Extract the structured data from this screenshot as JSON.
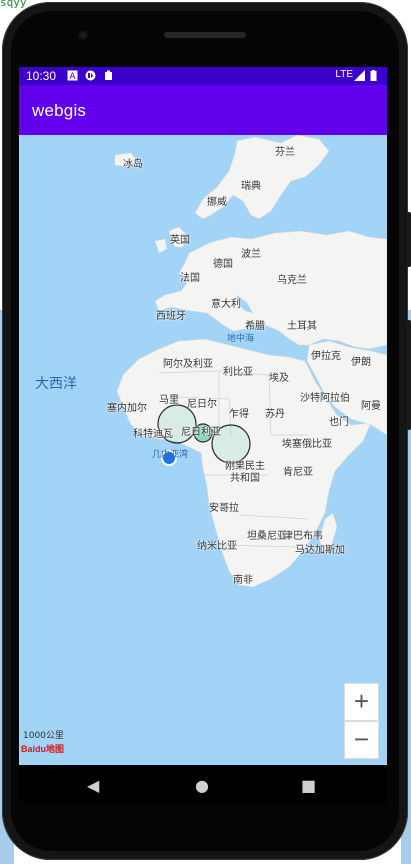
{
  "device": {
    "stray_text": "sqyy"
  },
  "status_bar": {
    "time": "10:30",
    "network_text": "LTE",
    "icons": [
      "a-icon",
      "data-icon",
      "clipboard-icon",
      "signal-icon",
      "battery-icon"
    ]
  },
  "app_bar": {
    "title": "webgis",
    "color": "#6200ee"
  },
  "map": {
    "ocean_label": "大西洋",
    "sea_label": "地中海",
    "country_labels": [
      "冰岛",
      "芬兰",
      "瑞典",
      "挪威",
      "英国",
      "德国",
      "波兰",
      "乌克兰",
      "法国",
      "意大利",
      "西班牙",
      "希腊",
      "土耳其",
      "阿尔及利亚",
      "利比亚",
      "埃及",
      "伊拉克",
      "伊朗",
      "沙特阿拉伯",
      "阿曼",
      "也门",
      "塞内加尔",
      "马里",
      "尼日尔",
      "乍得",
      "苏丹",
      "科特迪瓦",
      "尼日利亚",
      "几内亚湾",
      "埃塞俄比亚",
      "刚果民主",
      "共和国",
      "肯尼亚",
      "安哥拉",
      "坦桑尼亚",
      "津巴布韦",
      "纳米比亚",
      "马达加斯加",
      "南非"
    ],
    "scale_label": "1000公里",
    "logo_text": "Baidu地图"
  },
  "zoom_controls": {
    "zoom_in_label": "+",
    "zoom_out_label": "−"
  },
  "navigation": {
    "back_label": "◀",
    "home_label": "●",
    "recents_label": "■"
  },
  "colors": {
    "status_bar": "#3b00c9",
    "app_bar": "#6200ee",
    "ocean": "#a2d4f7",
    "land": "#f4f4f2",
    "marker_fill": "#5ec7a1",
    "current_location": "#1a73e8"
  }
}
